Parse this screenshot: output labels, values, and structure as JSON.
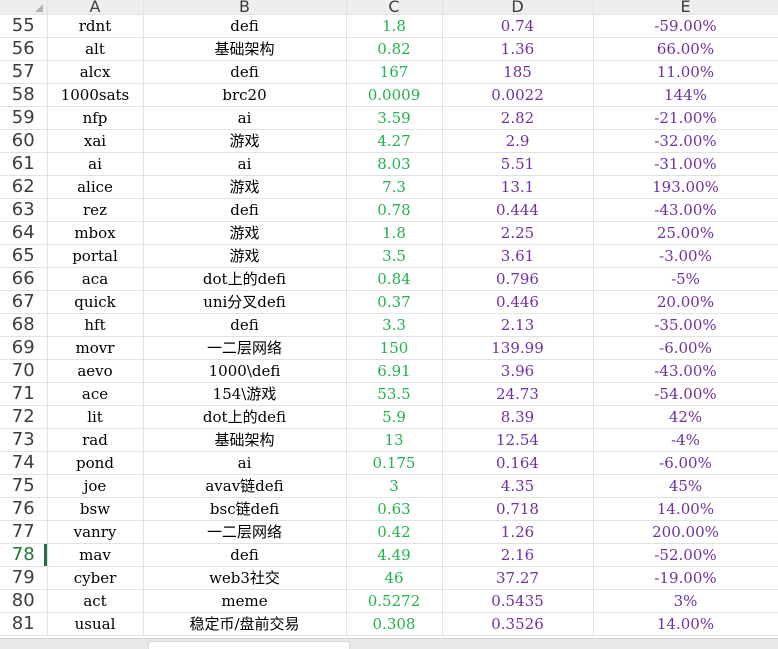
{
  "columns": [
    "A",
    "B",
    "C",
    "D",
    "E"
  ],
  "active_row": "78",
  "rows": [
    {
      "num": "55",
      "a": "rdnt",
      "b": "defi",
      "c": "1.8",
      "d": "0.74",
      "e": "-59.00%"
    },
    {
      "num": "56",
      "a": "alt",
      "b": "基础架构",
      "c": "0.82",
      "d": "1.36",
      "e": "66.00%"
    },
    {
      "num": "57",
      "a": "alcx",
      "b": "defi",
      "c": "167",
      "d": "185",
      "e": "11.00%"
    },
    {
      "num": "58",
      "a": "1000sats",
      "b": "brc20",
      "c": "0.0009",
      "d": "0.0022",
      "e": "144%"
    },
    {
      "num": "59",
      "a": "nfp",
      "b": "ai",
      "c": "3.59",
      "d": "2.82",
      "e": "-21.00%"
    },
    {
      "num": "60",
      "a": "xai",
      "b": "游戏",
      "c": "4.27",
      "d": "2.9",
      "e": "-32.00%"
    },
    {
      "num": "61",
      "a": "ai",
      "b": "ai",
      "c": "8.03",
      "d": "5.51",
      "e": "-31.00%"
    },
    {
      "num": "62",
      "a": "alice",
      "b": "游戏",
      "c": "7.3",
      "d": "13.1",
      "e": "193.00%"
    },
    {
      "num": "63",
      "a": "rez",
      "b": "defi",
      "c": "0.78",
      "d": "0.444",
      "e": "-43.00%"
    },
    {
      "num": "64",
      "a": "mbox",
      "b": "游戏",
      "c": "1.8",
      "d": "2.25",
      "e": "25.00%"
    },
    {
      "num": "65",
      "a": "portal",
      "b": "游戏",
      "c": "3.5",
      "d": "3.61",
      "e": "-3.00%"
    },
    {
      "num": "66",
      "a": "aca",
      "b": "dot上的defi",
      "c": "0.84",
      "d": "0.796",
      "e": "-5%"
    },
    {
      "num": "67",
      "a": "quick",
      "b": "uni分叉defi",
      "c": "0.37",
      "d": "0.446",
      "e": "20.00%"
    },
    {
      "num": "68",
      "a": "hft",
      "b": "defi",
      "c": "3.3",
      "d": "2.13",
      "e": "-35.00%"
    },
    {
      "num": "69",
      "a": "movr",
      "b": "一二层网络",
      "c": "150",
      "d": "139.99",
      "e": "-6.00%"
    },
    {
      "num": "70",
      "a": "aevo",
      "b": "1000\\defi",
      "c": "6.91",
      "d": "3.96",
      "e": "-43.00%"
    },
    {
      "num": "71",
      "a": "ace",
      "b": "154\\游戏",
      "c": "53.5",
      "d": "24.73",
      "e": "-54.00%"
    },
    {
      "num": "72",
      "a": "lit",
      "b": "dot上的defi",
      "c": "5.9",
      "d": "8.39",
      "e": "42%"
    },
    {
      "num": "73",
      "a": "rad",
      "b": "基础架构",
      "c": "13",
      "d": "12.54",
      "e": "-4%"
    },
    {
      "num": "74",
      "a": "pond",
      "b": "ai",
      "c": "0.175",
      "d": "0.164",
      "e": "-6.00%"
    },
    {
      "num": "75",
      "a": "joe",
      "b": "avav链defi",
      "c": "3",
      "d": "4.35",
      "e": "45%"
    },
    {
      "num": "76",
      "a": "bsw",
      "b": "bsc链defi",
      "c": "0.63",
      "d": "0.718",
      "e": "14.00%"
    },
    {
      "num": "77",
      "a": "vanry",
      "b": "一二层网络",
      "c": "0.42",
      "d": "1.26",
      "e": "200.00%"
    },
    {
      "num": "78",
      "a": "mav",
      "b": "defi",
      "c": "4.49",
      "d": "2.16",
      "e": "-52.00%"
    },
    {
      "num": "79",
      "a": "cyber",
      "b": "web3社交",
      "c": "46",
      "d": "37.27",
      "e": "-19.00%"
    },
    {
      "num": "80",
      "a": "act",
      "b": "meme",
      "c": "0.5272",
      "d": "0.5435",
      "e": "3%"
    },
    {
      "num": "81",
      "a": "usual",
      "b": "稳定币/盘前交易",
      "c": "0.308",
      "d": "0.3526",
      "e": "14.00%"
    }
  ],
  "colors": {
    "col_c_text": "#22b14c",
    "col_d_text": "#7030a0",
    "col_e_text": "#7030a0",
    "active_row_accent": "#217346"
  }
}
